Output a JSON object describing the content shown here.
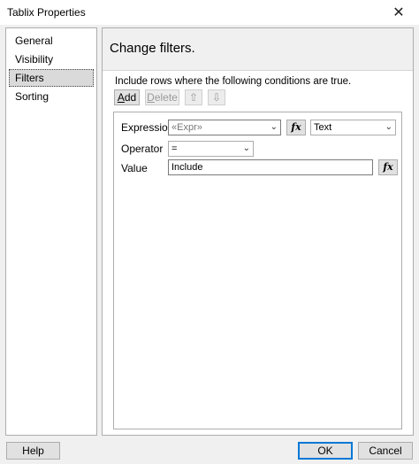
{
  "window": {
    "title": "Tablix Properties",
    "close_glyph": "✕"
  },
  "sidebar": {
    "items": [
      {
        "label": "General",
        "selected": false
      },
      {
        "label": "Visibility",
        "selected": false
      },
      {
        "label": "Filters",
        "selected": true
      },
      {
        "label": "Sorting",
        "selected": false
      }
    ]
  },
  "main": {
    "title": "Change filters.",
    "instructions": "Include rows where the following conditions are true.",
    "toolbar": {
      "add_label": "Add",
      "delete_label": "Delete",
      "move_up_glyph": "⇧",
      "move_down_glyph": "⇩"
    },
    "filter": {
      "expression_label": "Expression",
      "expression_value": "«Expr»",
      "fx_label": "fx",
      "type_value": "Text",
      "operator_label": "Operator",
      "operator_value": "=",
      "value_label": "Value",
      "value_value": "Include"
    }
  },
  "footer": {
    "help_label": "Help",
    "ok_label": "OK",
    "cancel_label": "Cancel"
  }
}
